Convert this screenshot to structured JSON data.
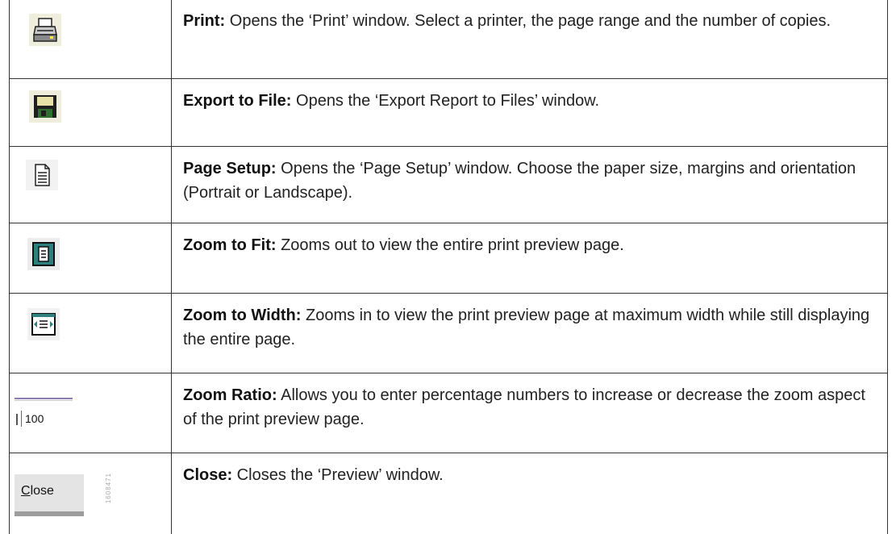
{
  "rows": [
    {
      "icon": "printer-icon",
      "term": "Print:",
      "desc": " Opens the ‘Print’ window. Select a printer, the page range and the number of copies."
    },
    {
      "icon": "floppy-disk-icon",
      "term": "Export to File:",
      "desc": " Opens the ‘Export Report to Files’ window."
    },
    {
      "icon": "page-setup-icon",
      "term": "Page Setup:",
      "desc": " Opens the ‘Page Setup’ window. Choose the paper size, margins and orientation (Portrait or Landscape)."
    },
    {
      "icon": "zoom-to-fit-icon",
      "term": "Zoom to Fit:",
      "desc": " Zooms out to view the entire print preview page."
    },
    {
      "icon": "zoom-to-width-icon",
      "term": "Zoom to Width:",
      "desc": " Zooms in to view the print preview page at maximum width while still displaying the entire page."
    },
    {
      "icon": "zoom-ratio-field",
      "term": "Zoom Ratio:",
      "desc": " Allows you to enter percentage numbers to increase or decrease the zoom aspect of the print preview page."
    },
    {
      "icon": "close-button",
      "term": "Close:",
      "desc": " Closes the ‘Preview’ window."
    }
  ],
  "zoom_ratio_value": "100",
  "close_button": {
    "first": "C",
    "rest": "lose"
  },
  "side_code": "1608471"
}
